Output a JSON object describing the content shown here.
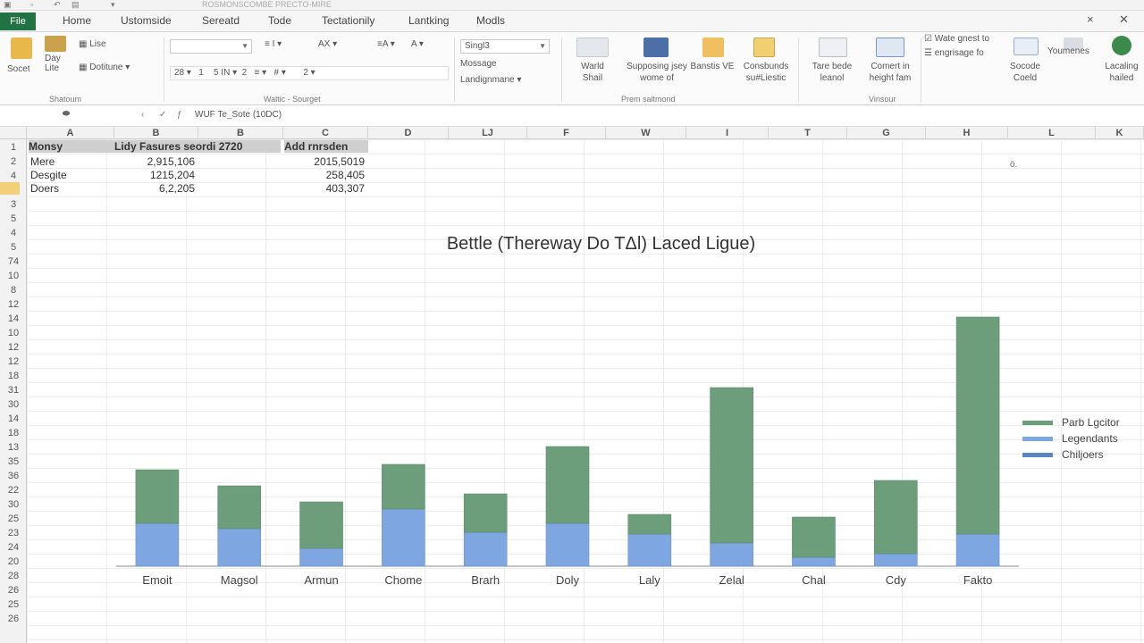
{
  "window": {
    "title": "ROSMONSCOMBE PRECTO-MIRE",
    "controls": [
      "×",
      "✕"
    ]
  },
  "tabs": [
    {
      "label": "File"
    },
    {
      "label": "Home"
    },
    {
      "label": "Ustomside"
    },
    {
      "label": "Sereatd"
    },
    {
      "label": "Tode"
    },
    {
      "label": "Tectationily"
    },
    {
      "label": "Lantking"
    },
    {
      "label": "Modls"
    }
  ],
  "ribbon": {
    "clipboard": {
      "socet": "Socet",
      "bay": "Day Lite",
      "lise": "Lise",
      "dotitune": "Dotitune",
      "group": "Shatoum"
    },
    "font": {
      "size_a": "AX",
      "size_b": "A",
      "size_c": "A",
      "row2_a": "28",
      "row2_b": "1",
      "row2_c": "5 IN",
      "row2_d": "2",
      "row2_e": "#",
      "row2_f": "2",
      "group": "Waltic - Sourget"
    },
    "number": {
      "format": "Singl3",
      "line1": "Mossage",
      "line2": "Landignmane",
      "group": ""
    },
    "styles": {
      "items": [
        {
          "label": "Warld Shail"
        },
        {
          "label": "Supposing jsey wome of"
        },
        {
          "label": "Banstis VE"
        },
        {
          "label": "Consbunds su#Liestic"
        }
      ],
      "group": "Prem saltmond"
    },
    "view": {
      "items": [
        {
          "label": "Tare bede leanol"
        },
        {
          "label": "Comert in height fam"
        }
      ],
      "group": "Vinsour"
    },
    "extra": {
      "line1": "Wate gnest to",
      "line2": "engrisage fo",
      "items": [
        {
          "label": "Socode Coeld"
        },
        {
          "label": "Youmenes"
        },
        {
          "label": "Lacaling hailed"
        }
      ]
    }
  },
  "formula": {
    "namebox": "",
    "controls": [
      "‹",
      "✓",
      "ƒ"
    ],
    "content": "WUF Te_Sote (10DC)"
  },
  "columns": [
    "A",
    "B",
    "B",
    "C",
    "D",
    "LJ",
    "F",
    "W",
    "I",
    "T",
    "G",
    "H",
    "L",
    "K"
  ],
  "rows": [
    "1",
    "2",
    "4",
    "4",
    "3",
    "5",
    "4",
    "5",
    "74",
    "10",
    "8",
    "12",
    "14",
    "10",
    "12",
    "12",
    "18",
    "31",
    "30",
    "14",
    "18",
    "13",
    "35",
    "36",
    "22",
    "30",
    "25",
    "23",
    "24",
    "20",
    "28",
    "26",
    "25",
    "26"
  ],
  "table": {
    "headers": [
      "Monsy",
      "Lidy Fasures seordi 2720",
      "Add rnrsden"
    ],
    "rows": [
      {
        "label": "Mere",
        "b": "2,915,106",
        "c": "2015,5019"
      },
      {
        "label": "Desgite",
        "b": "1215,204",
        "c": "258,405"
      },
      {
        "label": "Doers",
        "b": "6,2,205",
        "c": "403,307"
      }
    ],
    "stray": "ö."
  },
  "chart_data": {
    "type": "bar",
    "stacked": true,
    "title": "Bettle (Thereway Do TΔl) Laced Ligue)",
    "categories": [
      "Emoit",
      "Magsol",
      "Armun",
      "Chome",
      "Brarh",
      "Doly",
      "Laly",
      "Zelal",
      "Chal",
      "Cdy",
      "Fakto"
    ],
    "series": [
      {
        "name": "Chiljoers",
        "color": "#5a86c6",
        "values": [
          0,
          0,
          0,
          0,
          0,
          0,
          0,
          0,
          0,
          0,
          0
        ]
      },
      {
        "name": "Legendants",
        "color": "#7ea6e0",
        "values": [
          48,
          42,
          20,
          64,
          38,
          48,
          36,
          26,
          10,
          14,
          36
        ]
      },
      {
        "name": "Parb Lgcitor",
        "color": "#6c9e7c",
        "values": [
          60,
          48,
          52,
          50,
          43,
          86,
          22,
          174,
          45,
          82,
          243
        ]
      }
    ],
    "xlabel": "",
    "ylabel": "",
    "ylim": [
      0,
      290
    ],
    "grid": false,
    "legend_position": "right"
  }
}
